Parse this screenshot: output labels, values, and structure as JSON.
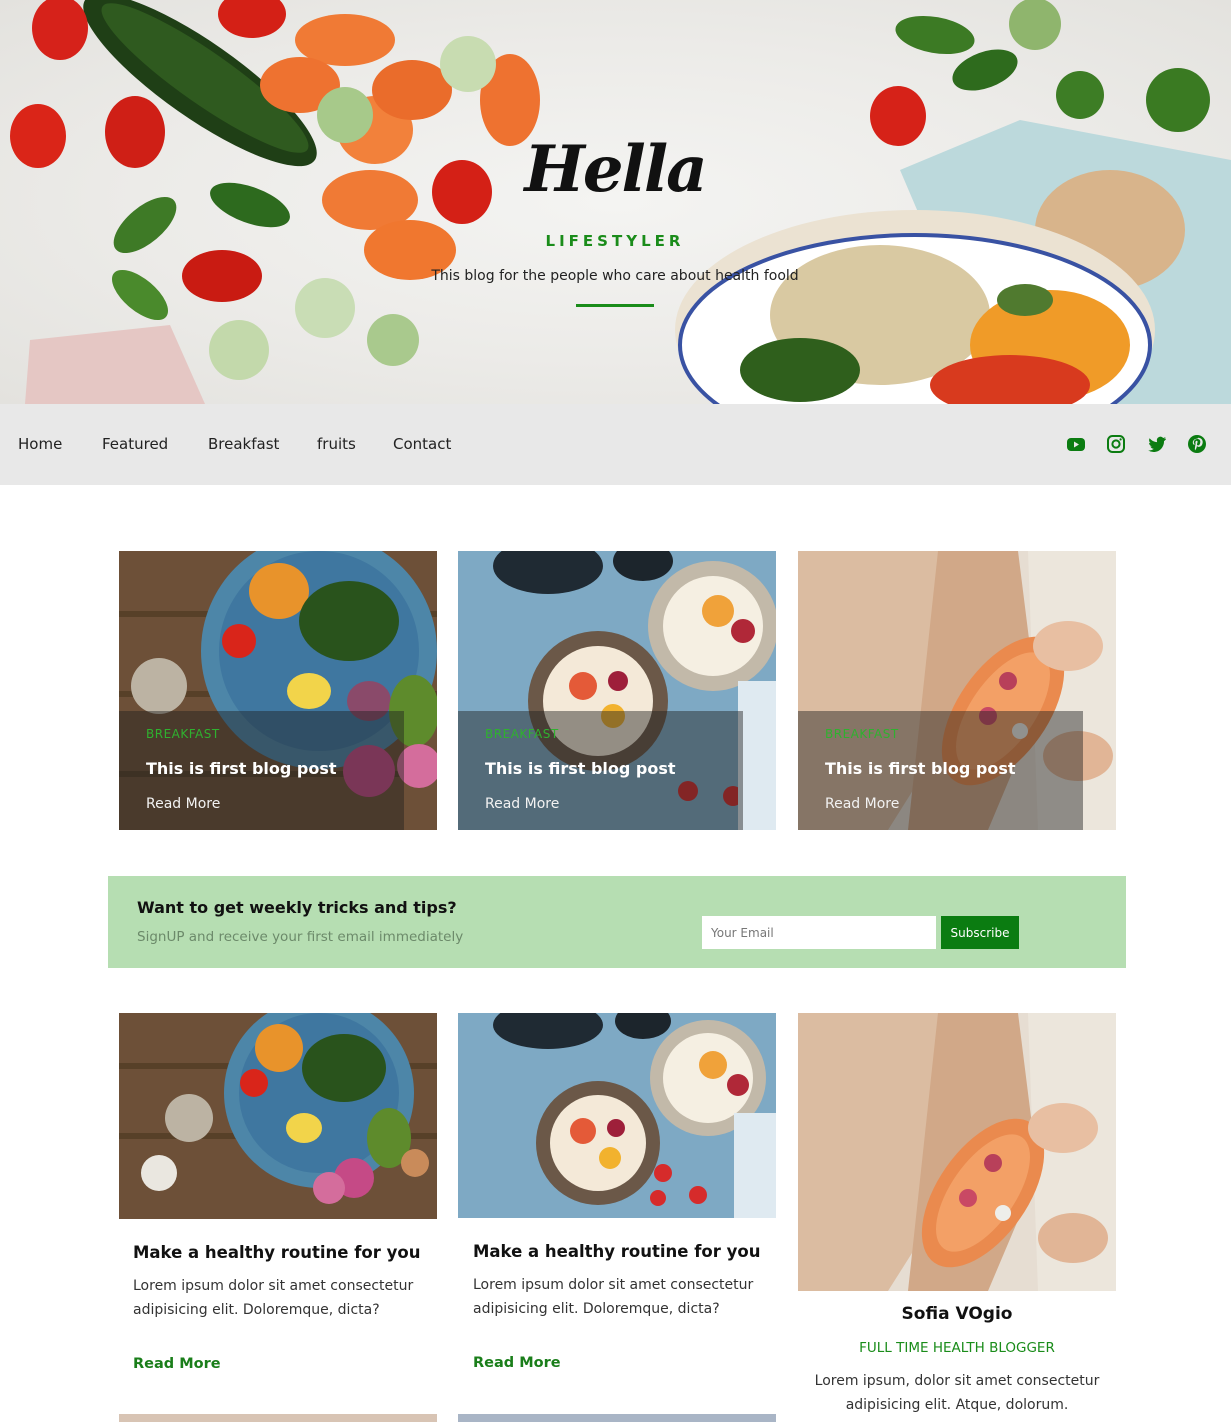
{
  "colors": {
    "accent": "#1a8c1a",
    "nav_bg": "#e8e8e8",
    "newsletter_bg": "#b6deb2",
    "subscribe_bg": "#0b7c11"
  },
  "hero": {
    "logo": "Hella",
    "tagline": "LIFESTYLER",
    "subtitle": "This blog for the people who care about health foold"
  },
  "nav": {
    "items": [
      "Home",
      "Featured",
      "Breakfast",
      "fruits",
      "Contact"
    ],
    "social_icons": [
      "youtube-icon",
      "instagram-icon",
      "twitter-icon",
      "pinterest-icon"
    ]
  },
  "featured": [
    {
      "category": "BREAKFAST",
      "title": "This is first blog post",
      "link": "Read More"
    },
    {
      "category": "BREAKFAST",
      "title": "This is first blog post",
      "link": "Read More"
    },
    {
      "category": "BREAKFAST",
      "title": "This is first blog post",
      "link": "Read More"
    }
  ],
  "newsletter": {
    "title": "Want to get weekly tricks and tips?",
    "subtitle": "SignUP and receive your first email immediately",
    "placeholder": "Your Email",
    "button": "Subscribe"
  },
  "posts": [
    {
      "title": "Make a healthy routine for you",
      "excerpt": "Lorem ipsum dolor sit amet consectetur adipisicing elit. Doloremque, dicta?",
      "link": "Read More"
    },
    {
      "title": "Make a healthy routine for you",
      "excerpt": "Lorem ipsum dolor sit amet consectetur adipisicing elit. Doloremque, dicta?",
      "link": "Read More"
    }
  ],
  "author": {
    "name": "Sofia VOgio",
    "role": "FULL TIME HEALTH BLOGGER",
    "bio": "Lorem ipsum, dolor sit amet consectetur adipisicing elit. Atque, dolorum."
  }
}
